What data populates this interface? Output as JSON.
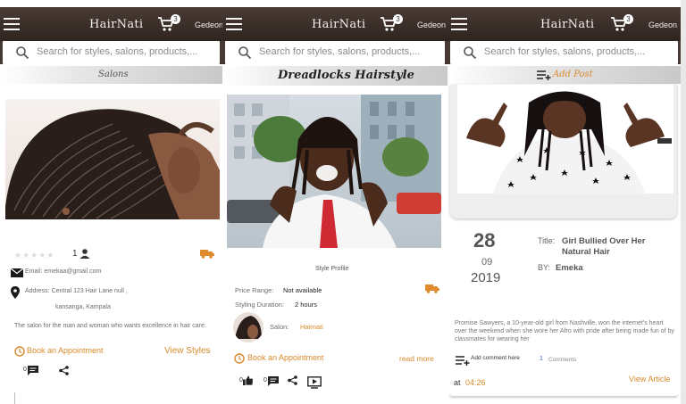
{
  "app": {
    "brand": "HairNati",
    "cart_count": "3",
    "user": "Gedeon"
  },
  "search": {
    "placeholder": "Search for styles, salons, products,..."
  },
  "salon_panel": {
    "section_title": "Salons",
    "rating_count": "1",
    "email": "Email: emekaa@gmail.com",
    "address_line1": "Address: Central 123 Hair Lane null ,",
    "address_line2": "kansanga, Kampala",
    "description": "The salon for the man and woman who wants excellence in hair care.",
    "book_label": "Book an Appointment",
    "view_styles_label": "View Styles",
    "comment_count": "0"
  },
  "style_panel": {
    "section_title": "Dreadlocks Hairstyle",
    "profile_label": "Style Profile",
    "price_label": "Price Range:",
    "price_value": "Not available",
    "duration_label": "Styling Duration:",
    "duration_value": "2 hours",
    "salon_label": "Salon:",
    "salon_value": "Hairnati",
    "book_label": "Book an Appointment",
    "read_more_label": "read more",
    "like_count": "0",
    "comment_count": "0"
  },
  "article_panel": {
    "add_post_label": "Add Post",
    "day": "28",
    "month": "09",
    "year": "2019",
    "title_label": "Title:",
    "title_value": "Girl Bullied Over Her Natural Hair",
    "by_label": "BY:",
    "by_value": "Emeka",
    "excerpt": "Promise Sawyers, a 10-year-old girl from Nashville, won the internet's heart over the weekend when she wore her Afro with pride after being made fun of by classmates for wearing her",
    "add_comment_label": "Add comment here",
    "comments_count": "1",
    "comments_label": "Comments",
    "at_label": "at",
    "time_value": "04:26",
    "view_article_label": "View Article"
  },
  "colors": {
    "appbar": "#3a2d28",
    "accent": "#d98a2b",
    "search_bg": "#463832"
  }
}
